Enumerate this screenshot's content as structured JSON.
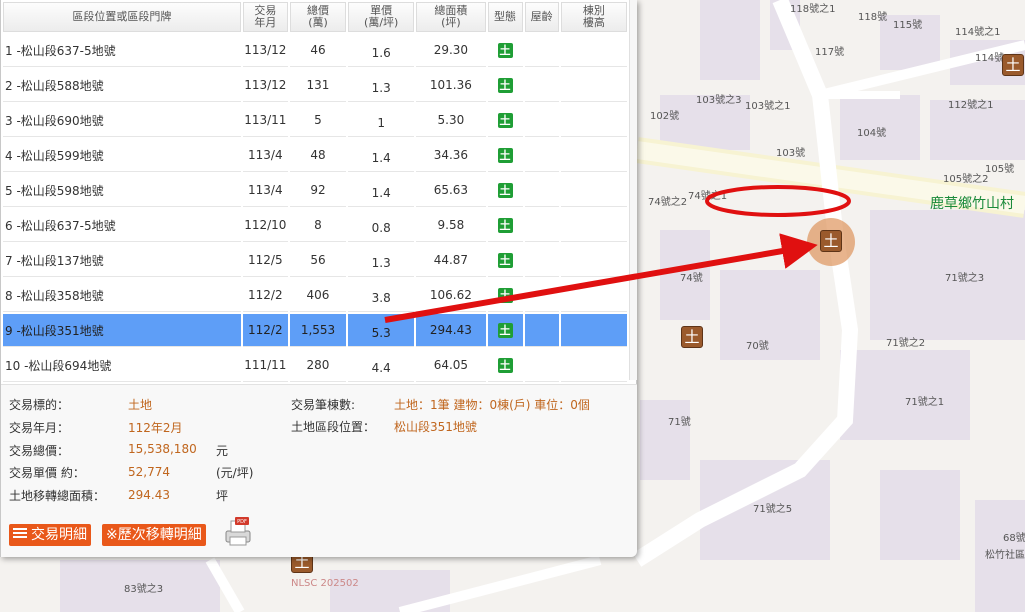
{
  "table": {
    "headers": [
      "區段位置或區段門牌",
      "交易\n年月",
      "總價\n(萬)",
      "單價\n(萬/坪)",
      "總面積\n(坪)",
      "型態",
      "屋齡",
      "棟別\n樓高"
    ],
    "rows": [
      {
        "loc": "1  -松山段637-5地號",
        "ym": "113/12",
        "total": "46",
        "unit": "1.6",
        "area": "29.30",
        "type": "土"
      },
      {
        "loc": "2  -松山段588地號",
        "ym": "113/12",
        "total": "131",
        "unit": "1.3",
        "area": "101.36",
        "type": "土"
      },
      {
        "loc": "3  -松山段690地號",
        "ym": "113/11",
        "total": "5",
        "unit": "1",
        "area": "5.30",
        "type": "土"
      },
      {
        "loc": "4  -松山段599地號",
        "ym": "113/4",
        "total": "48",
        "unit": "1.4",
        "area": "34.36",
        "type": "土"
      },
      {
        "loc": "5  -松山段598地號",
        "ym": "113/4",
        "total": "92",
        "unit": "1.4",
        "area": "65.63",
        "type": "土"
      },
      {
        "loc": "6  -松山段637-5地號",
        "ym": "112/10",
        "total": "8",
        "unit": "0.8",
        "area": "9.58",
        "type": "土"
      },
      {
        "loc": "7  -松山段137地號",
        "ym": "112/5",
        "total": "56",
        "unit": "1.3",
        "area": "44.87",
        "type": "土"
      },
      {
        "loc": "8  -松山段358地號",
        "ym": "112/2",
        "total": "406",
        "unit": "3.8",
        "area": "106.62",
        "type": "土"
      },
      {
        "loc": "9  -松山段351地號",
        "ym": "112/2",
        "total": "1,553",
        "unit": "5.3",
        "area": "294.43",
        "type": "土"
      },
      {
        "loc": "10  -松山段694地號",
        "ym": "111/11",
        "total": "280",
        "unit": "4.4",
        "area": "64.05",
        "type": "土"
      }
    ],
    "selected_index": 8
  },
  "detail": {
    "target_label": "交易標的：",
    "target_value": "土地",
    "date_label": "交易年月：",
    "date_value": "112年2月",
    "total_label": "交易總價：",
    "total_value": "15,538,180",
    "total_unit": "元",
    "unit_label": "交易單價 約：",
    "unit_value": "52,774",
    "unit_unit": "(元/坪)",
    "area_label": "土地移轉總面積：",
    "area_value": "294.43",
    "area_unit": "坪",
    "count_label": "交易筆棟數:",
    "count_value": "土地：1筆 建物：0棟(戶) 車位：0個",
    "landloc_label": "土地區段位置：",
    "landloc_value": "松山段351地號",
    "btn_detail": "交易明細",
    "btn_history": "※歷次移轉明細",
    "pdf_label": "PDF"
  },
  "map": {
    "village": "鹿草鄉竹山村",
    "marker_glyph": "土",
    "nlsc": "NLSC 202502",
    "labels": [
      "118號之1",
      "118號",
      "115號",
      "114號之1",
      "114號",
      "117號",
      "103號之3",
      "103號之1",
      "102號",
      "112號之1",
      "104號",
      "103號",
      "105號",
      "105號之2",
      "74號之2",
      "74號之1",
      "71號之3",
      "74號",
      "70號",
      "71號之2",
      "71號之1",
      "71號",
      "71號之5",
      "68號",
      "松竹社區",
      "83號之3"
    ]
  },
  "colors": {
    "selected_row": "#5e9ef7",
    "type_tag": "#1f9e35",
    "accent_orange": "#e9581a",
    "value_text": "#c0661e",
    "annotation_red": "#e01010",
    "village_green": "#1b8a3a"
  }
}
